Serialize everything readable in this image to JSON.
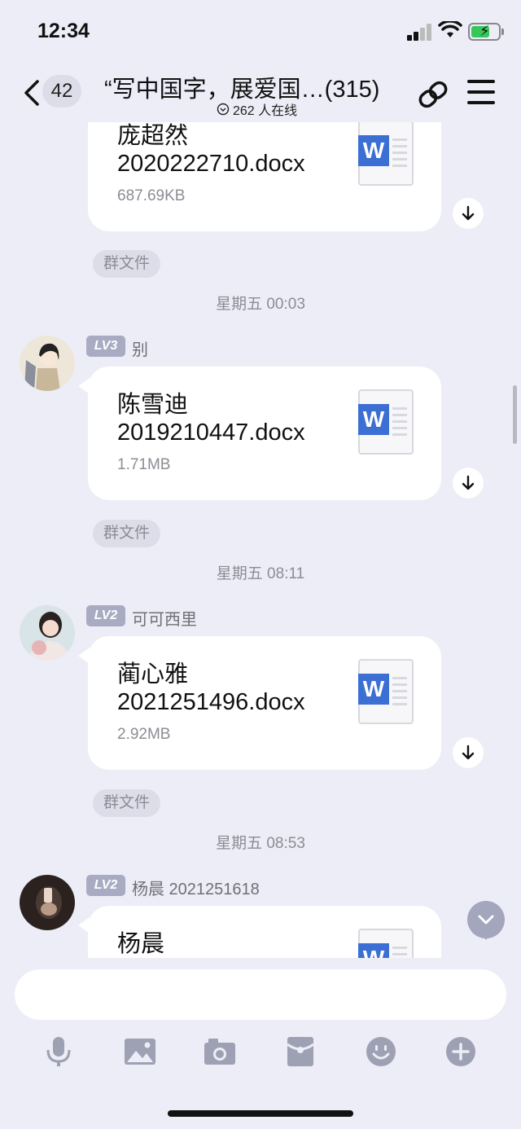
{
  "status_bar": {
    "time": "12:34"
  },
  "header": {
    "unread_count": "42",
    "title": "“写中国字，展爱国…(315)",
    "online_status": "262 人在线"
  },
  "messages": [
    {
      "type": "file",
      "file_name_line1": "庞超然",
      "file_name_line2": "2020222710.docx",
      "file_size": "687.69KB",
      "tag": "群文件"
    },
    {
      "type": "timestamp",
      "text": "星期五 00:03"
    },
    {
      "type": "file",
      "level": "LV3",
      "sender": "别",
      "file_name_line1": "陈雪迪",
      "file_name_line2": "2019210447.docx",
      "file_size": "1.71MB",
      "tag": "群文件"
    },
    {
      "type": "timestamp",
      "text": "星期五 08:11"
    },
    {
      "type": "file",
      "level": "LV2",
      "sender": "可可西里",
      "file_name_line1": "蔺心雅",
      "file_name_line2": "2021251496.docx",
      "file_size": "2.92MB",
      "tag": "群文件"
    },
    {
      "type": "timestamp",
      "text": "星期五 08:53"
    },
    {
      "type": "file",
      "level": "LV2",
      "sender": "杨晨 2021251618",
      "file_name_line1": "杨晨"
    }
  ],
  "input": {
    "placeholder": ""
  },
  "toolbar": [
    "microphone-icon",
    "image-icon",
    "camera-icon",
    "red-packet-icon",
    "emoji-icon",
    "plus-icon"
  ],
  "colors": {
    "background": "#ecedf6",
    "bubble": "#ffffff",
    "word_blue": "#3b6fd3",
    "level_badge": "#a9abc3",
    "secondary_text": "#8c8c95"
  }
}
